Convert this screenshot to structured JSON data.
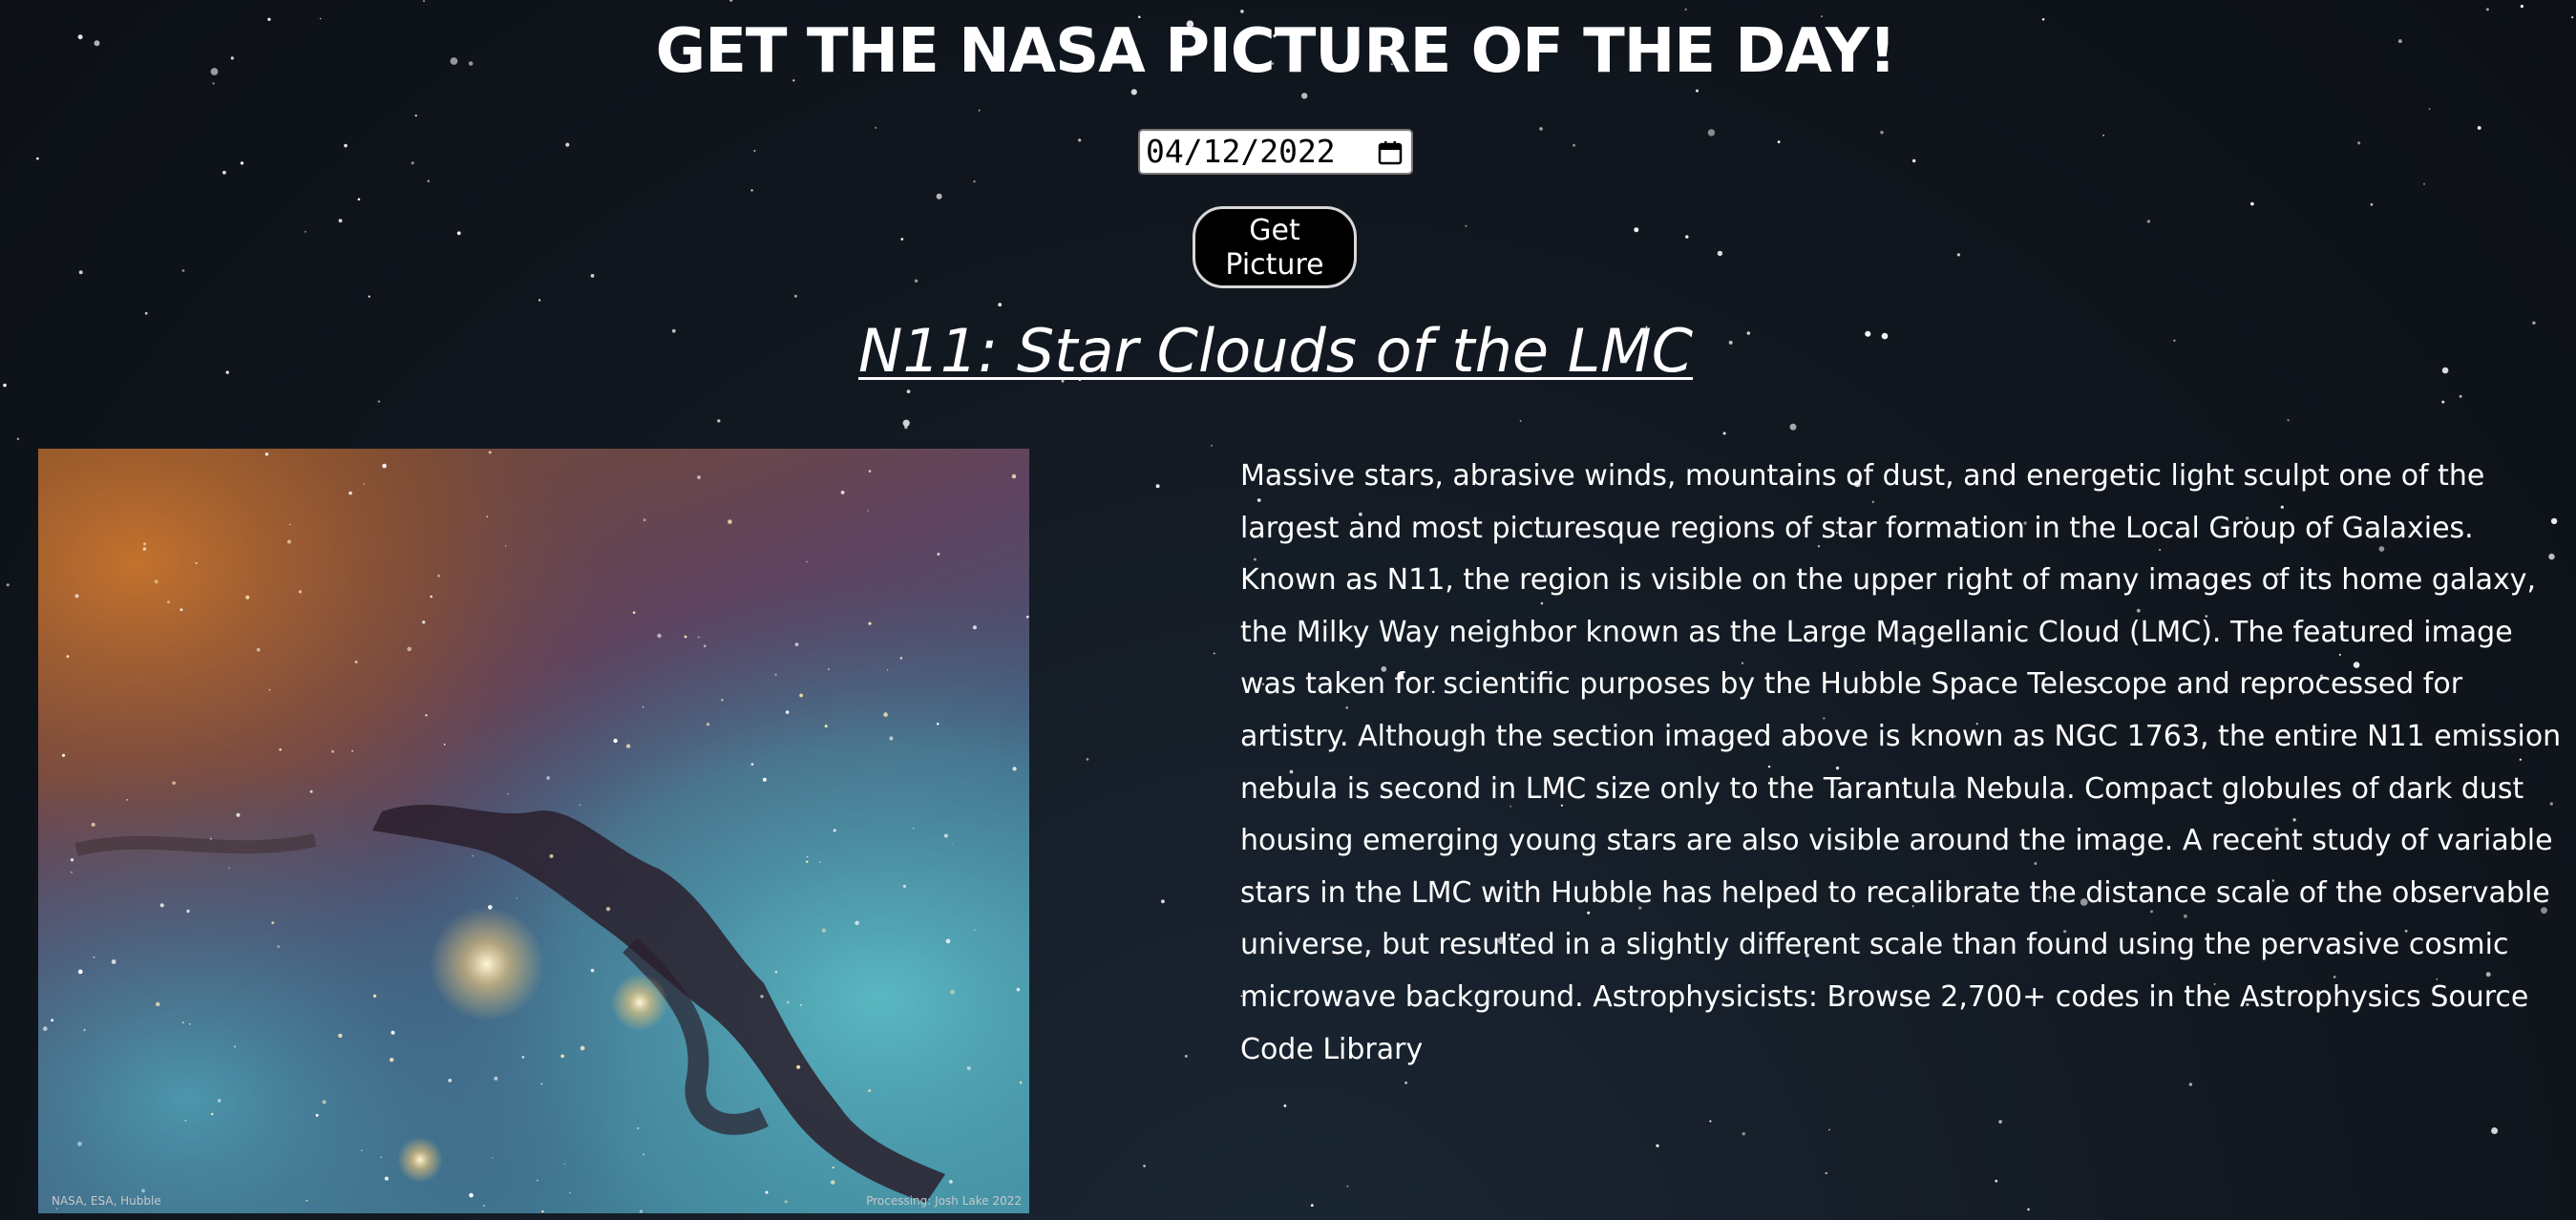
{
  "header": {
    "title": "GET THE NASA PICTURE OF THE DAY!"
  },
  "form": {
    "date_value": "04/12/2022",
    "button_label": "Get Picture"
  },
  "apod": {
    "title": "N11: Star Clouds of the LMC",
    "credit_left": "NASA, ESA, Hubble",
    "credit_right": "Processing: Josh Lake 2022",
    "explanation": "Massive stars, abrasive winds, mountains of dust, and energetic light sculpt one of the largest and most picturesque regions of star formation in the Local Group of Galaxies. Known as N11, the region is visible on the upper right of many images of its home galaxy, the Milky Way neighbor known as the Large Magellanic Cloud (LMC). The featured image was taken for scientific purposes by the Hubble Space Telescope and reprocessed for artistry. Although the section imaged above is known as NGC 1763, the entire N11 emission nebula is second in LMC size only to the Tarantula Nebula. Compact globules of dark dust housing emerging young stars are also visible around the image. A recent study of variable stars in the LMC with Hubble has helped to recalibrate the distance scale of the observable universe, but resulted in a slightly different scale than found using the pervasive cosmic microwave background. Astrophysicists: Browse 2,700+ codes in the Astrophysics Source Code Library"
  },
  "colors": {
    "background": "#121820",
    "text": "#ffffff",
    "button_bg": "#000000"
  }
}
